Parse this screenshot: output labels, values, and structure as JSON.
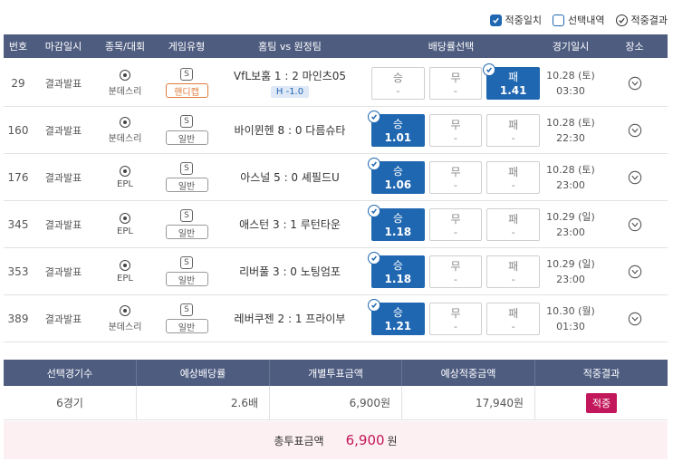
{
  "legend": [
    {
      "label": "적중일치",
      "style": "check"
    },
    {
      "label": "선택내역",
      "style": "empty"
    },
    {
      "label": "적중결과",
      "style": "circle"
    }
  ],
  "columns": [
    "번호",
    "마감일시",
    "종목/대회",
    "게임유형",
    "홈팀 vs 원정팀",
    "배당률선택",
    "경기일시",
    "장소"
  ],
  "game_icon": "S",
  "rows": [
    {
      "no": "29",
      "deadline": "결과발표",
      "league": "분데스리",
      "type": "핸디캡",
      "type_kind": "hcp",
      "match": "VfL보훔 1 : 2 마인츠05",
      "handicap": "H -1.0",
      "odds": [
        {
          "label": "승",
          "value": "-",
          "selected": false
        },
        {
          "label": "무",
          "value": "-",
          "selected": false
        },
        {
          "label": "패",
          "value": "1.41",
          "selected": true
        }
      ],
      "date": "10.28 (토)",
      "time": "03:30"
    },
    {
      "no": "160",
      "deadline": "결과발표",
      "league": "분데스리",
      "type": "일반",
      "type_kind": "normal",
      "match": "바이뮌헨 8 : 0 다름슈타",
      "handicap": "",
      "odds": [
        {
          "label": "승",
          "value": "1.01",
          "selected": true
        },
        {
          "label": "무",
          "value": "-",
          "selected": false
        },
        {
          "label": "패",
          "value": "-",
          "selected": false
        }
      ],
      "date": "10.28 (토)",
      "time": "22:30"
    },
    {
      "no": "176",
      "deadline": "결과발표",
      "league": "EPL",
      "type": "일반",
      "type_kind": "normal",
      "match": "아스널 5 : 0 셰필드U",
      "handicap": "",
      "odds": [
        {
          "label": "승",
          "value": "1.06",
          "selected": true
        },
        {
          "label": "무",
          "value": "-",
          "selected": false
        },
        {
          "label": "패",
          "value": "-",
          "selected": false
        }
      ],
      "date": "10.28 (토)",
      "time": "23:00"
    },
    {
      "no": "345",
      "deadline": "결과발표",
      "league": "EPL",
      "type": "일반",
      "type_kind": "normal",
      "match": "애스턴 3 : 1 루턴타운",
      "handicap": "",
      "odds": [
        {
          "label": "승",
          "value": "1.18",
          "selected": true
        },
        {
          "label": "무",
          "value": "-",
          "selected": false
        },
        {
          "label": "패",
          "value": "-",
          "selected": false
        }
      ],
      "date": "10.29 (일)",
      "time": "23:00"
    },
    {
      "no": "353",
      "deadline": "결과발표",
      "league": "EPL",
      "type": "일반",
      "type_kind": "normal",
      "match": "리버풀 3 : 0 노팅엄포",
      "handicap": "",
      "odds": [
        {
          "label": "승",
          "value": "1.18",
          "selected": true
        },
        {
          "label": "무",
          "value": "-",
          "selected": false
        },
        {
          "label": "패",
          "value": "-",
          "selected": false
        }
      ],
      "date": "10.29 (일)",
      "time": "23:00"
    },
    {
      "no": "389",
      "deadline": "결과발표",
      "league": "분데스리",
      "type": "일반",
      "type_kind": "normal",
      "match": "레버쿠젠 2 : 1 프라이부",
      "handicap": "",
      "odds": [
        {
          "label": "승",
          "value": "1.21",
          "selected": true
        },
        {
          "label": "무",
          "value": "-",
          "selected": false
        },
        {
          "label": "패",
          "value": "-",
          "selected": false
        }
      ],
      "date": "10.30 (월)",
      "time": "01:30"
    }
  ],
  "summary": {
    "headers": [
      "선택경기수",
      "예상배당률",
      "개별투표금액",
      "예상적중금액",
      "적중결과"
    ],
    "games": "6경기",
    "odds": "2.6배",
    "bet_amount": "6,900원",
    "expected": "17,940원",
    "result": "적중"
  },
  "total": {
    "label": "총투표금액",
    "value": "6,900",
    "unit": "원"
  },
  "colors": {
    "header": "#4e5c80",
    "accent": "#1f67b1",
    "result": "#c2185b",
    "handicap": "#e07b3a"
  }
}
